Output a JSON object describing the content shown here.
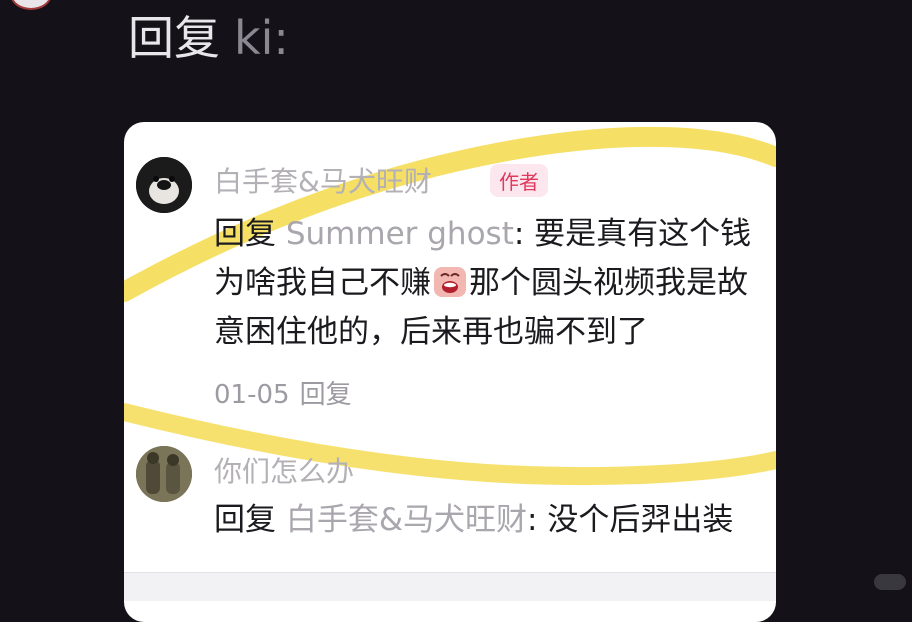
{
  "header": {
    "reply_word": "回复",
    "reply_name": "ki:"
  },
  "comments": [
    {
      "author": "白手套&马犬旺财",
      "author_tag": "作者",
      "reply_word": "回复",
      "reply_to": "Summer ghost",
      "text_part1": ": 要是真有这个钱为啥我自己不赚",
      "emoji": "crying-laughing-emoji",
      "text_part2": "那个圆头视频我是故意困住他的，后来再也骗不到了",
      "date": "01-05",
      "reply_action": "回复"
    },
    {
      "author": "你们怎么办",
      "reply_word": "回复",
      "reply_to": "白手套&马犬旺财",
      "text": ": 没个后羿出装"
    }
  ],
  "colors": {
    "background": "#141218",
    "card": "#ffffff",
    "highlight": "#f5d94a",
    "author_tag": "#e0385e"
  }
}
